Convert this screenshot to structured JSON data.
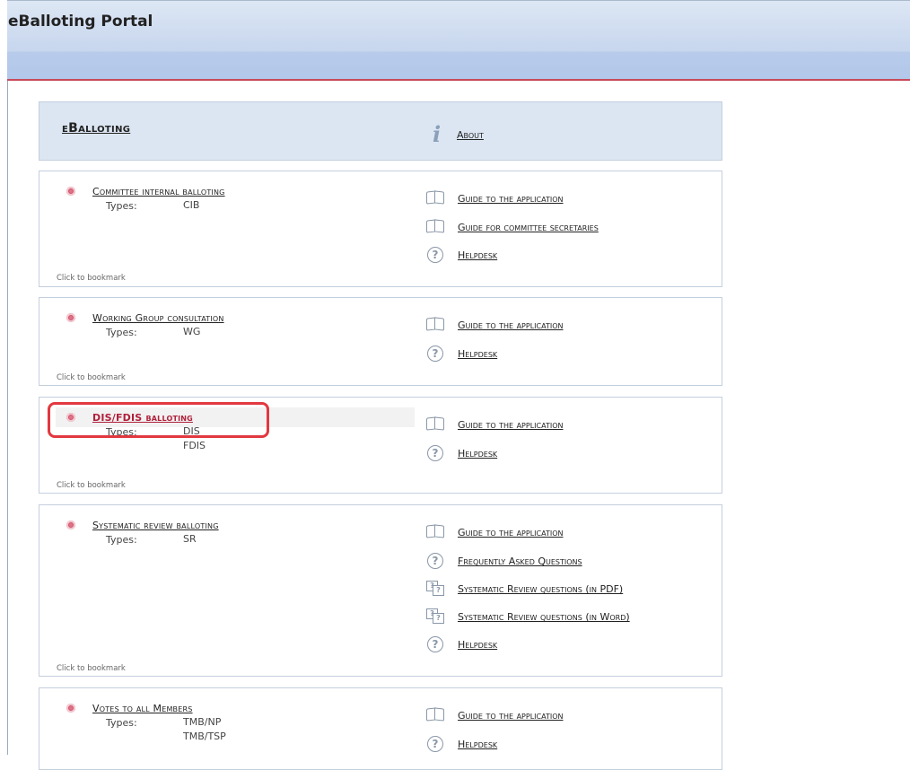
{
  "header": {
    "title": "eBalloting Portal"
  },
  "top_panel": {
    "title": "eBalloting",
    "about_label": "About"
  },
  "bookmark_label": "Click to bookmark",
  "types_label": "Types:",
  "services": [
    {
      "title": "Committee internal balloting",
      "types": [
        "CIB"
      ],
      "links": [
        {
          "icon": "book-icon",
          "label": "Guide to the application"
        },
        {
          "icon": "book-icon",
          "label": "Guide for committee secretaries"
        },
        {
          "icon": "help-icon",
          "label": "Helpdesk"
        }
      ]
    },
    {
      "title": "Working Group consultation",
      "types": [
        "WG"
      ],
      "links": [
        {
          "icon": "book-icon",
          "label": "Guide to the application"
        },
        {
          "icon": "help-icon",
          "label": "Helpdesk"
        }
      ]
    },
    {
      "title": "DIS/FDIS balloting",
      "types": [
        "DIS",
        "FDIS"
      ],
      "links": [
        {
          "icon": "book-icon",
          "label": "Guide to the application"
        },
        {
          "icon": "help-icon",
          "label": "Helpdesk"
        }
      ]
    },
    {
      "title": "Systematic review balloting",
      "types": [
        "SR"
      ],
      "links": [
        {
          "icon": "book-icon",
          "label": "Guide to the application"
        },
        {
          "icon": "help-icon",
          "label": "Frequently Asked Questions"
        },
        {
          "icon": "faq-icon",
          "label": "Systematic Review questions (in PDF)"
        },
        {
          "icon": "faq-icon",
          "label": "Systematic Review questions (in Word)"
        },
        {
          "icon": "help-icon",
          "label": "Helpdesk"
        }
      ]
    },
    {
      "title": "Votes to all Members",
      "types": [
        "TMB/NP",
        "TMB/TSP"
      ],
      "links": [
        {
          "icon": "book-icon",
          "label": "Guide to the application"
        },
        {
          "icon": "help-icon",
          "label": "Helpdesk"
        }
      ]
    }
  ]
}
